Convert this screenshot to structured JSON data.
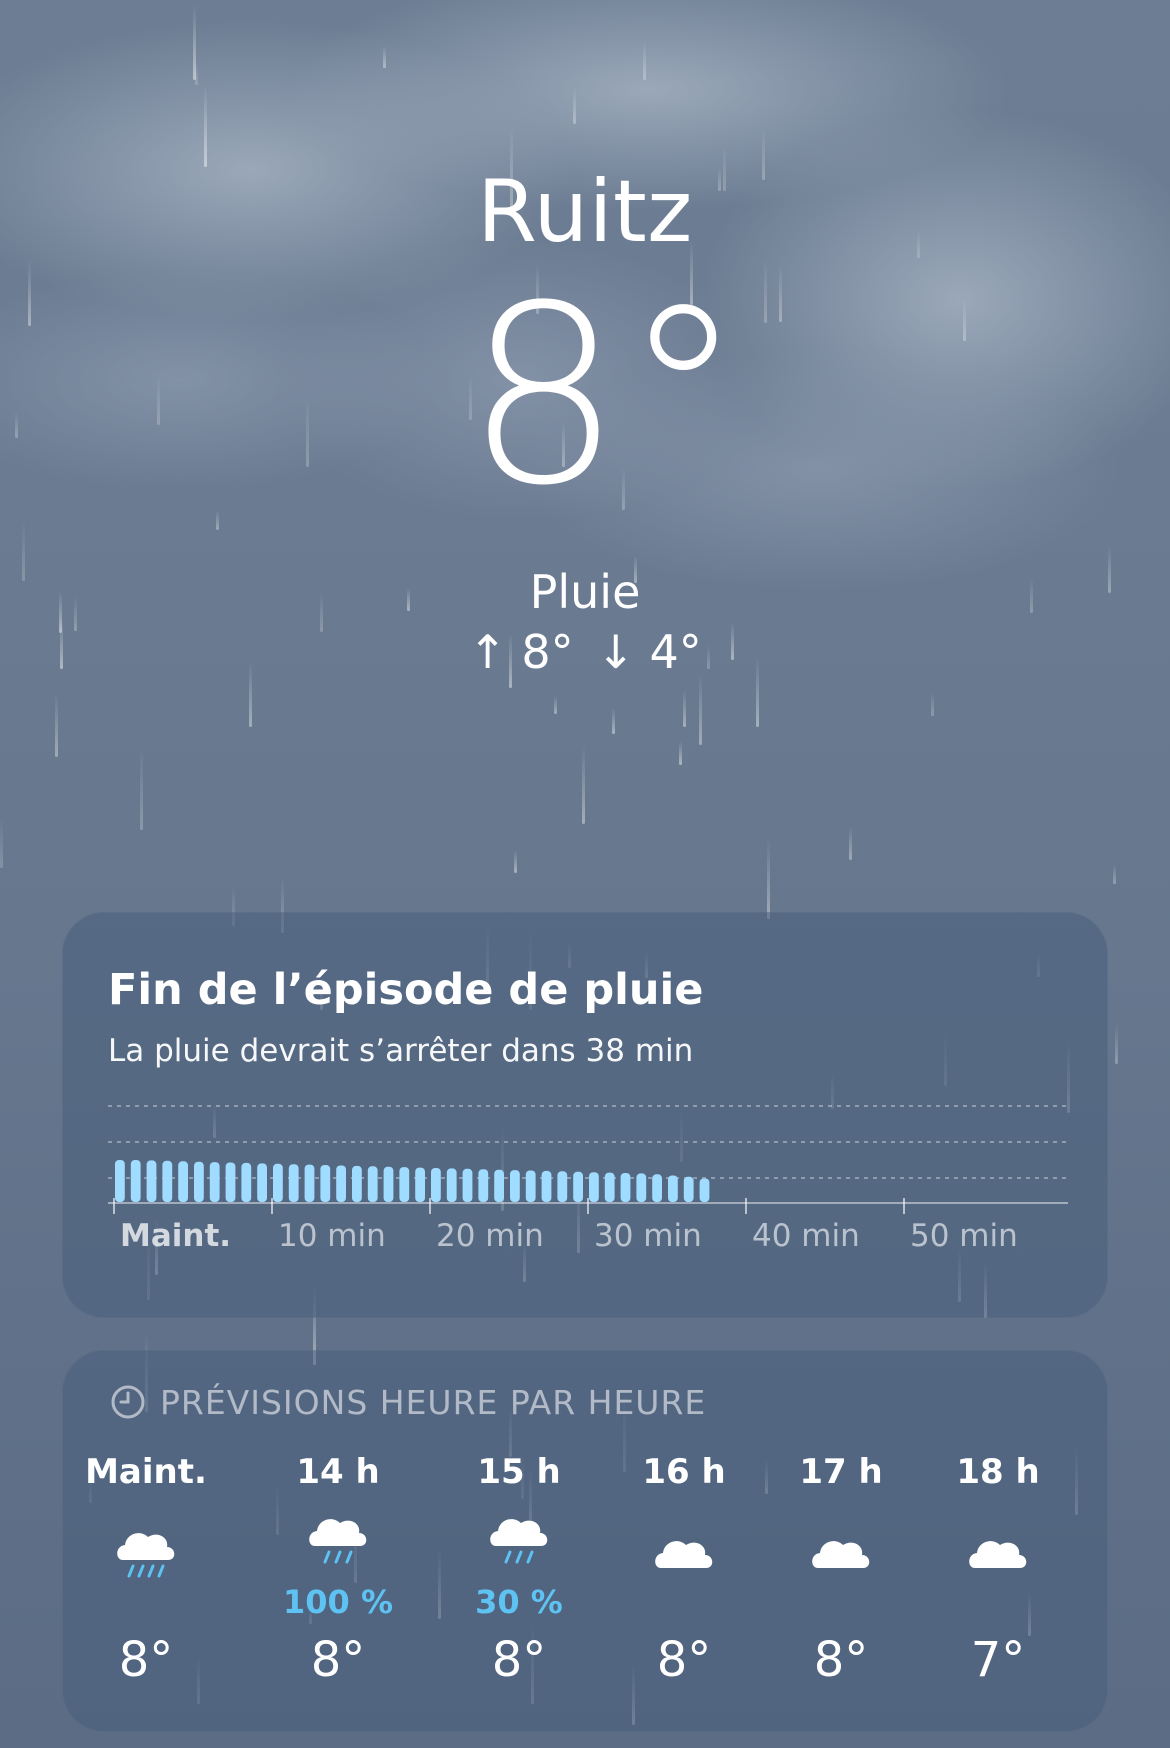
{
  "location": {
    "city": "Ruitz",
    "temperature": "8°",
    "condition": "Pluie",
    "high": "↑ 8°",
    "low": "↓ 4°"
  },
  "rain_card": {
    "title": "Fin de l’épisode de pluie",
    "subtitle": "La pluie devrait s’arrêter dans 38 min",
    "axis_labels": [
      "Maint.",
      "10 min",
      "20 min",
      "30 min",
      "40 min",
      "50 min"
    ],
    "bar_color": "#9fdcff"
  },
  "hourly_card": {
    "header": "PRÉVISIONS HEURE PAR HEURE",
    "hours": [
      {
        "time": "Maint.",
        "icon": "cloud-rain-icon",
        "precip": "",
        "temp": "8°"
      },
      {
        "time": "14 h",
        "icon": "cloud-drizzle-icon",
        "precip": "100 %",
        "temp": "8°"
      },
      {
        "time": "15 h",
        "icon": "cloud-drizzle-icon",
        "precip": "30 %",
        "temp": "8°"
      },
      {
        "time": "16 h",
        "icon": "cloud-icon",
        "precip": "",
        "temp": "8°"
      },
      {
        "time": "17 h",
        "icon": "cloud-icon",
        "precip": "",
        "temp": "8°"
      },
      {
        "time": "18 h",
        "icon": "cloud-icon",
        "precip": "",
        "temp": "7°"
      }
    ]
  },
  "chart_data": {
    "type": "bar",
    "x_unit": "min",
    "x": [
      0,
      1,
      2,
      3,
      4,
      5,
      6,
      7,
      8,
      9,
      10,
      11,
      12,
      13,
      14,
      15,
      16,
      17,
      18,
      19,
      20,
      21,
      22,
      23,
      24,
      25,
      26,
      27,
      28,
      29,
      30,
      31,
      32,
      33,
      34,
      35,
      36,
      37
    ],
    "values": [
      1.0,
      1.0,
      0.99,
      0.98,
      0.97,
      0.96,
      0.95,
      0.94,
      0.93,
      0.92,
      0.91,
      0.9,
      0.89,
      0.88,
      0.87,
      0.86,
      0.85,
      0.84,
      0.83,
      0.82,
      0.81,
      0.8,
      0.79,
      0.78,
      0.77,
      0.76,
      0.75,
      0.74,
      0.73,
      0.72,
      0.71,
      0.7,
      0.69,
      0.68,
      0.66,
      0.63,
      0.6,
      0.56
    ],
    "xlim": [
      0,
      60
    ],
    "tick_labels": [
      "Maint.",
      "10 min",
      "20 min",
      "30 min",
      "40 min",
      "50 min"
    ],
    "grid": true
  },
  "colors": {
    "accent": "#5ec3f2",
    "card_bg": "#485e7c",
    "rain_bar": "#9fdcff"
  }
}
